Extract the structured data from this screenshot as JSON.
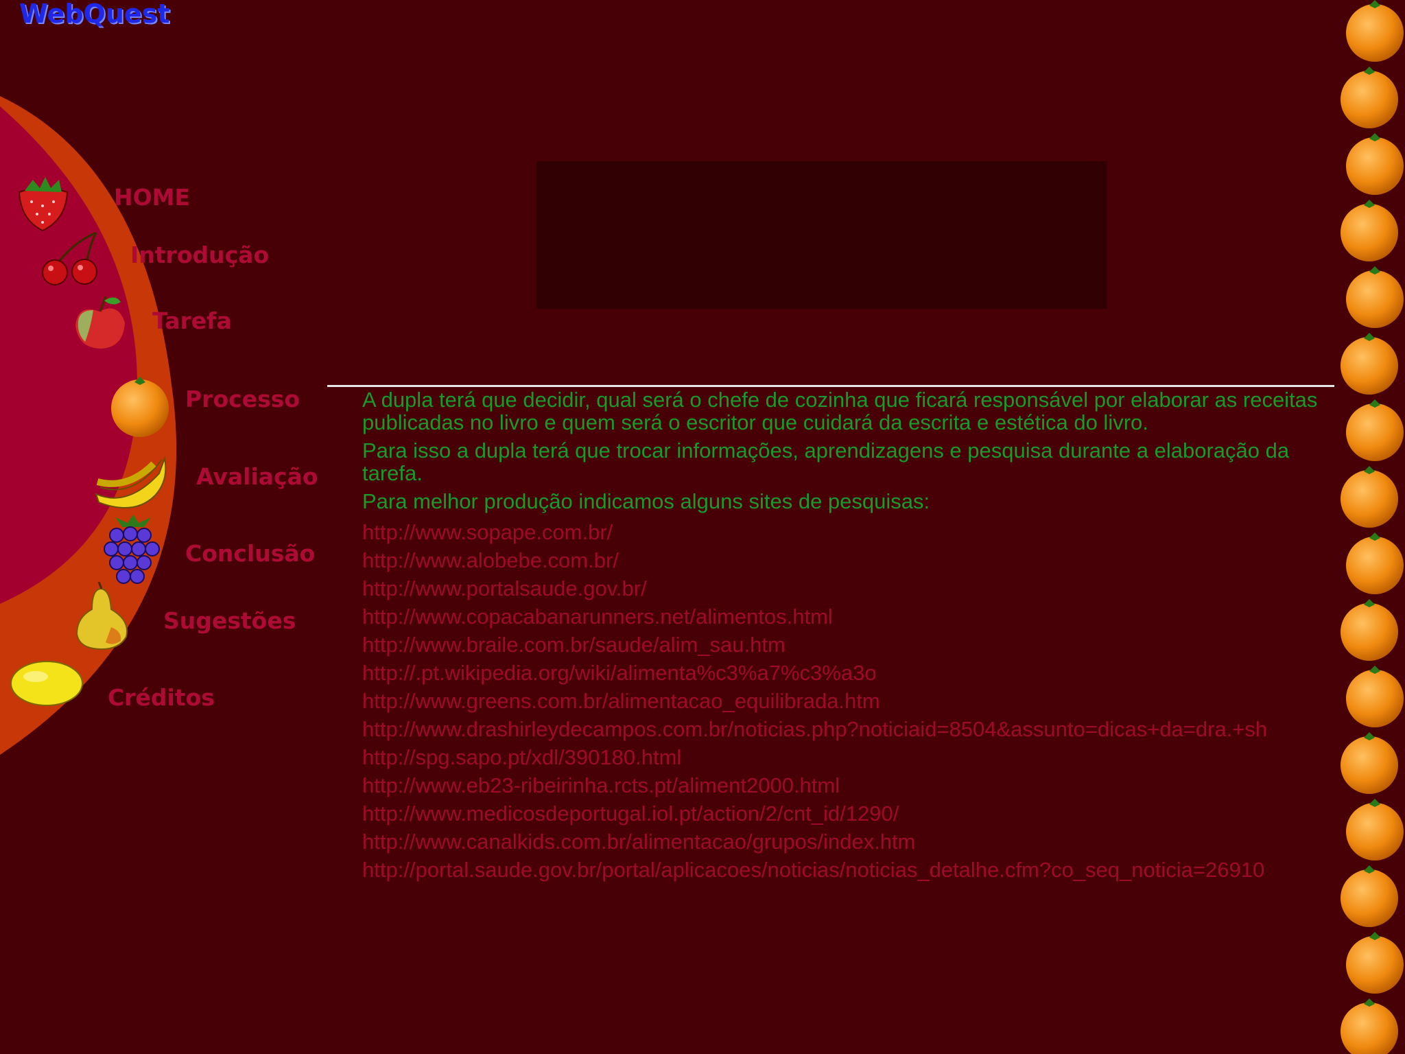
{
  "logo": "WebQuest",
  "nav": [
    {
      "label": "HOME",
      "icon": "strawberry-icon"
    },
    {
      "label": "Introdução",
      "icon": "cherries-icon"
    },
    {
      "label": "Tarefa",
      "icon": "apple-icon"
    },
    {
      "label": "Processo",
      "icon": "orange-icon"
    },
    {
      "label": "Avaliação",
      "icon": "banana-icon"
    },
    {
      "label": "Conclusão",
      "icon": "grapes-icon"
    },
    {
      "label": "Sugestões",
      "icon": "pear-icon"
    },
    {
      "label": "Créditos",
      "icon": "lemon-icon"
    }
  ],
  "content": {
    "paragraphs": [
      "A dupla terá que decidir, qual será o chefe de cozinha que ficará responsável por elaborar as receitas publicadas no livro e quem será o escritor que cuidará da escrita e estética do livro.",
      "Para isso a dupla terá que trocar informações, aprendizagens e pesquisa durante a elaboração da tarefa.",
      "Para melhor produção indicamos alguns sites de pesquisas:"
    ],
    "links": [
      "http://www.sopape.com.br/",
      "http://www.alobebe.com.br/",
      "http://www.portalsaude.gov.br/",
      "http://www.copacabanarunners.net/alimentos.html",
      "http://www.braile.com.br/saude/alim_sau.htm",
      "http://.pt.wikipedia.org/wiki/alimenta%c3%a7%c3%a3o",
      "http://www.greens.com.br/alimentacao_equilibrada.htm",
      "http://www.drashirleydecampos.com.br/noticias.php?noticiaid=8504&assunto=dicas+da=dra.+sh",
      "http://spg.sapo.pt/xdl/390180.html",
      "http://www.eb23-ribeirinha.rcts.pt/aliment2000.html",
      "http://www.medicosdeportugal.iol.pt/action/2/cnt_id/1290/",
      "http://www.canalkids.com.br/alimentacao/grupos/index.htm",
      "http://portal.saude.gov.br/portal/aplicacoes/noticias/noticias_detalhe.cfm?co_seq_noticia=26910"
    ]
  },
  "colors": {
    "background": "#470005",
    "nav_text": "#ad0a36",
    "body_text": "#1a9a2a",
    "link": "#9d0a2c",
    "arc_inner": "#a3002f",
    "arc_outer": "#c83708"
  }
}
